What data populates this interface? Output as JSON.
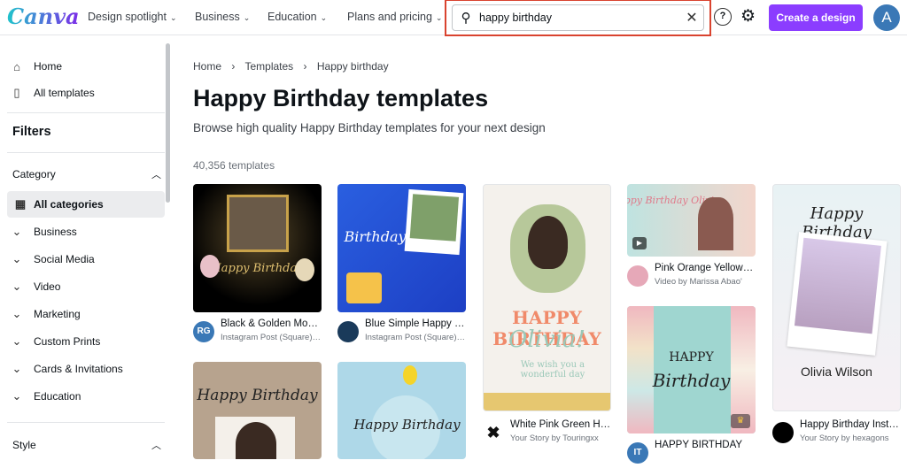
{
  "header": {
    "logo": "Canva",
    "nav": [
      "Design spotlight",
      "Business",
      "Education",
      "Plans and pricing"
    ],
    "search_value": "happy birthday",
    "create_label": "Create a design",
    "avatar_initial": "A",
    "help_icon": "?"
  },
  "sidebar": {
    "home": "Home",
    "all_templates": "All templates",
    "filters": "Filters",
    "category": "Category",
    "categories": [
      "All categories",
      "Business",
      "Social Media",
      "Video",
      "Marketing",
      "Custom Prints",
      "Cards & Invitations",
      "Education"
    ],
    "style": "Style"
  },
  "main": {
    "breadcrumb": [
      "Home",
      "Templates",
      "Happy birthday"
    ],
    "title": "Happy Birthday templates",
    "subtitle": "Browse high quality Happy Birthday templates for your next design",
    "count": "40,356 templates"
  },
  "templates": [
    {
      "title": "Black & Golden Modern Happy Birthday",
      "subtitle": "Instagram Post (Square) by RG",
      "avatar": "RG"
    },
    {
      "title": "Blue Simple Happy Birthday",
      "subtitle": "Instagram Post (Square) by ...",
      "avatar": ""
    },
    {
      "title": "White Pink Green Happy Birthday",
      "subtitle": "Your Story by Touringxx",
      "avatar": ""
    },
    {
      "title": "Pink Orange Yellow Birthday",
      "subtitle": "Video by Marissa Abao'",
      "avatar": ""
    },
    {
      "title": "Happy Birthday Instagram Story",
      "subtitle": "Your Story by hexagons",
      "avatar": ""
    },
    {
      "title": "HAPPY BIRTHDAY",
      "subtitle": "",
      "avatar": "IT"
    }
  ],
  "thumb_text": {
    "t1": "Happy Birthday",
    "t2": "Happy Birthday",
    "t3": "HAPPY BIRTHDAY",
    "t3b": "Olivia!",
    "t3c": "We wish you a wonderful day",
    "t4": "Happy Birthday Olivia",
    "t5": "Happy Birthday",
    "t5b": "Olivia Wilson",
    "t6": "Happy Birthday",
    "t7": "Birthday",
    "t8": "HAPPY",
    "t8b": "Birthday"
  },
  "colors": {
    "accent": "#8b3dff",
    "search_highlight": "#d9432f",
    "avatar": "#3a78b6"
  }
}
